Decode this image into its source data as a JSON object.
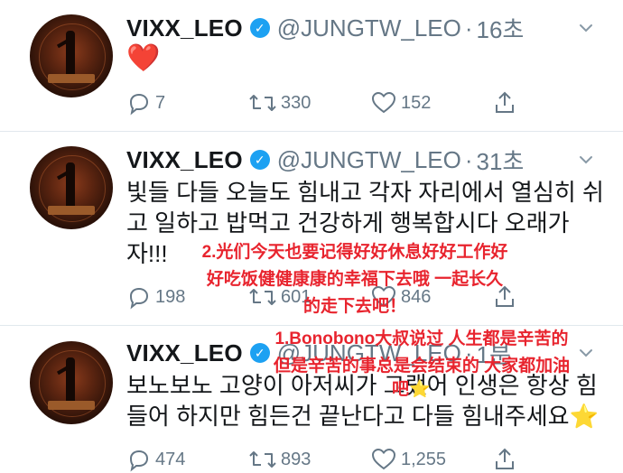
{
  "tweets": [
    {
      "name": "VIXX_LEO",
      "handle": "@JUNGTW_LEO",
      "dot": "·",
      "time": "16초",
      "text": "❤️",
      "replies": "7",
      "retweets": "330",
      "likes": "152"
    },
    {
      "name": "VIXX_LEO",
      "handle": "@JUNGTW_LEO",
      "dot": "·",
      "time": "31초",
      "text_lines": [
        "빛들 다들 오늘도 힘내고 각자 자리에서 열심히 쉬",
        "고 일하고 밥먹고 건강하게 행복합시다 오래가",
        "자!!!"
      ],
      "replies": "198",
      "retweets": "601",
      "likes": "846"
    },
    {
      "name": "VIXX_LEO",
      "handle": "@JUNGTW_LEO",
      "dot": "·",
      "time": "1분",
      "text_lines": [
        "보노보노 고양이 아저씨가 그랬어 인생은 항상 힘",
        "들어 하지만 힘든건 끝난다고 다들 힘내주세요"
      ],
      "replies": "474",
      "retweets": "893",
      "likes": "1,255"
    }
  ],
  "overlays": {
    "note2_lines": [
      "2.光们今天也要记得好好休息好好工作好",
      "好吃饭健健康康的幸福下去哦 一起长久",
      "的走下去吧！"
    ],
    "note1_lines": [
      "1.Bonobono大叔说过 人生都是辛苦的",
      "但是辛苦的事总是会结束的 大家都加油",
      "吧"
    ]
  },
  "icons": [
    "verified-badge-icon",
    "chevron-down-icon",
    "reply-icon",
    "retweet-icon",
    "like-icon",
    "share-icon",
    "star-emoji"
  ],
  "colors": {
    "verified": "#1da1f2",
    "meta": "#657786",
    "overlay_text": "#e8242e",
    "heart": "#e0245e"
  }
}
